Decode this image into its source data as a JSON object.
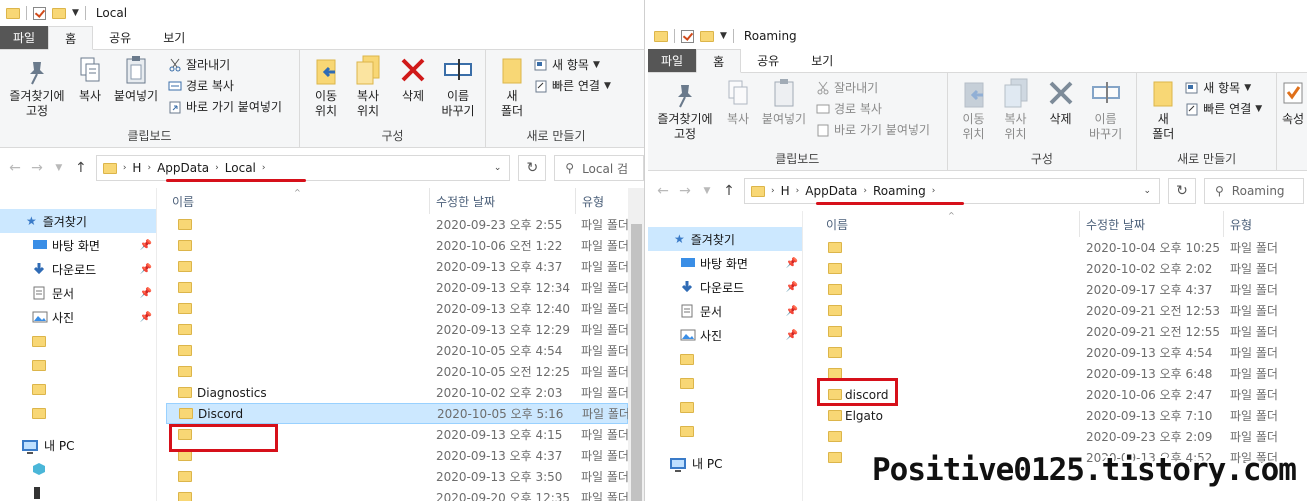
{
  "watermark": "Positive0125.tistory.com",
  "colors": {
    "accent_red": "#d6101a",
    "selection": "#cce8ff",
    "folder": "#f8d775",
    "file_tab": "#565656"
  },
  "left": {
    "title": "Local",
    "tabs": [
      "파일",
      "홈",
      "공유",
      "보기"
    ],
    "ribbon": {
      "pin_label_1": "즐겨찾기에",
      "pin_label_2": "고정",
      "copy": "복사",
      "paste": "붙여넣기",
      "cut": "잘라내기",
      "copy_path": "경로 복사",
      "paste_shortcut": "바로 가기 붙여넣기",
      "clipboard_group": "클립보드",
      "move_1": "이동",
      "move_2": "위치",
      "copyto_1": "복사",
      "copyto_2": "위치",
      "delete": "삭제",
      "rename_1": "이름",
      "rename_2": "바꾸기",
      "organize_group": "구성",
      "newfolder_1": "새",
      "newfolder_2": "폴더",
      "newitem": "새 항목",
      "easyaccess": "빠른 연결",
      "new_group": "새로 만들기"
    },
    "path": [
      "H",
      "AppData",
      "Local"
    ],
    "search_placeholder": "Local 검",
    "headers": {
      "name": "이름",
      "date": "수정한 날짜",
      "type": "유형"
    },
    "nav": {
      "quick_access": "즐겨찾기",
      "items": [
        "바탕 화면",
        "다운로드",
        "문서",
        "사진"
      ],
      "this_pc": "내 PC"
    },
    "rows": [
      {
        "name": "",
        "date": "2020-09-23 오후 2:55",
        "type": "파일 폴더"
      },
      {
        "name": "",
        "date": "2020-10-06 오전 1:22",
        "type": "파일 폴더"
      },
      {
        "name": "",
        "date": "2020-09-13 오후 4:37",
        "type": "파일 폴더"
      },
      {
        "name": "",
        "date": "2020-09-13 오후 12:34",
        "type": "파일 폴더"
      },
      {
        "name": "",
        "date": "2020-09-13 오후 12:40",
        "type": "파일 폴더"
      },
      {
        "name": "",
        "date": "2020-09-13 오후 12:29",
        "type": "파일 폴더"
      },
      {
        "name": "",
        "date": "2020-10-05 오후 4:54",
        "type": "파일 폴더"
      },
      {
        "name": "",
        "date": "2020-10-05 오전 12:25",
        "type": "파일 폴더"
      },
      {
        "name": "Diagnostics",
        "date": "2020-10-02 오후 2:03",
        "type": "파일 폴더"
      },
      {
        "name": "Discord",
        "date": "2020-10-05 오후 5:16",
        "type": "파일 폴더"
      },
      {
        "name": "",
        "date": "2020-09-13 오후 4:15",
        "type": "파일 폴더"
      },
      {
        "name": "",
        "date": "2020-09-13 오후 4:37",
        "type": "파일 폴더"
      },
      {
        "name": "",
        "date": "2020-09-13 오후 3:50",
        "type": "파일 폴더"
      },
      {
        "name": "",
        "date": "2020-09-20 오후 12:35",
        "type": "파일 폴더"
      }
    ]
  },
  "right": {
    "title": "Roaming",
    "tabs": [
      "파일",
      "홈",
      "공유",
      "보기"
    ],
    "ribbon": {
      "pin_label_1": "즐겨찾기에",
      "pin_label_2": "고정",
      "copy": "복사",
      "paste": "붙여넣기",
      "cut": "잘라내기",
      "copy_path": "경로 복사",
      "paste_shortcut": "바로 가기 붙여넣기",
      "clipboard_group": "클립보드",
      "move_1": "이동",
      "move_2": "위치",
      "copyto_1": "복사",
      "copyto_2": "위치",
      "delete": "삭제",
      "rename_1": "이름",
      "rename_2": "바꾸기",
      "organize_group": "구성",
      "newfolder_1": "새",
      "newfolder_2": "폴더",
      "newitem": "새 항목",
      "easyaccess": "빠른 연결",
      "new_group": "새로 만들기",
      "props": "속성"
    },
    "path": [
      "H",
      "AppData",
      "Roaming"
    ],
    "search_placeholder": "Roaming",
    "headers": {
      "name": "이름",
      "date": "수정한 날짜",
      "type": "유형"
    },
    "nav": {
      "quick_access": "즐겨찾기",
      "items": [
        "바탕 화면",
        "다운로드",
        "문서",
        "사진"
      ],
      "this_pc": "내 PC"
    },
    "rows": [
      {
        "name": "",
        "date": "2020-10-04 오후 10:25",
        "type": "파일 폴더"
      },
      {
        "name": "",
        "date": "2020-10-02 오후 2:02",
        "type": "파일 폴더"
      },
      {
        "name": "",
        "date": "2020-09-17 오후 4:37",
        "type": "파일 폴더"
      },
      {
        "name": "",
        "date": "2020-09-21 오전 12:53",
        "type": "파일 폴더"
      },
      {
        "name": "",
        "date": "2020-09-21 오전 12:55",
        "type": "파일 폴더"
      },
      {
        "name": "",
        "date": "2020-09-13 오후 4:54",
        "type": "파일 폴더"
      },
      {
        "name": "",
        "date": "2020-09-13 오후 6:48",
        "type": "파일 폴더"
      },
      {
        "name": "discord",
        "date": "2020-10-06 오후 2:47",
        "type": "파일 폴더"
      },
      {
        "name": "Elgato",
        "date": "2020-09-13 오후 7:10",
        "type": "파일 폴더"
      },
      {
        "name": "",
        "date": "2020-09-23 오후 2:09",
        "type": "파일 폴더"
      },
      {
        "name": "",
        "date": "2020-09-13 오후 4:52",
        "type": "파일 폴더"
      }
    ]
  }
}
